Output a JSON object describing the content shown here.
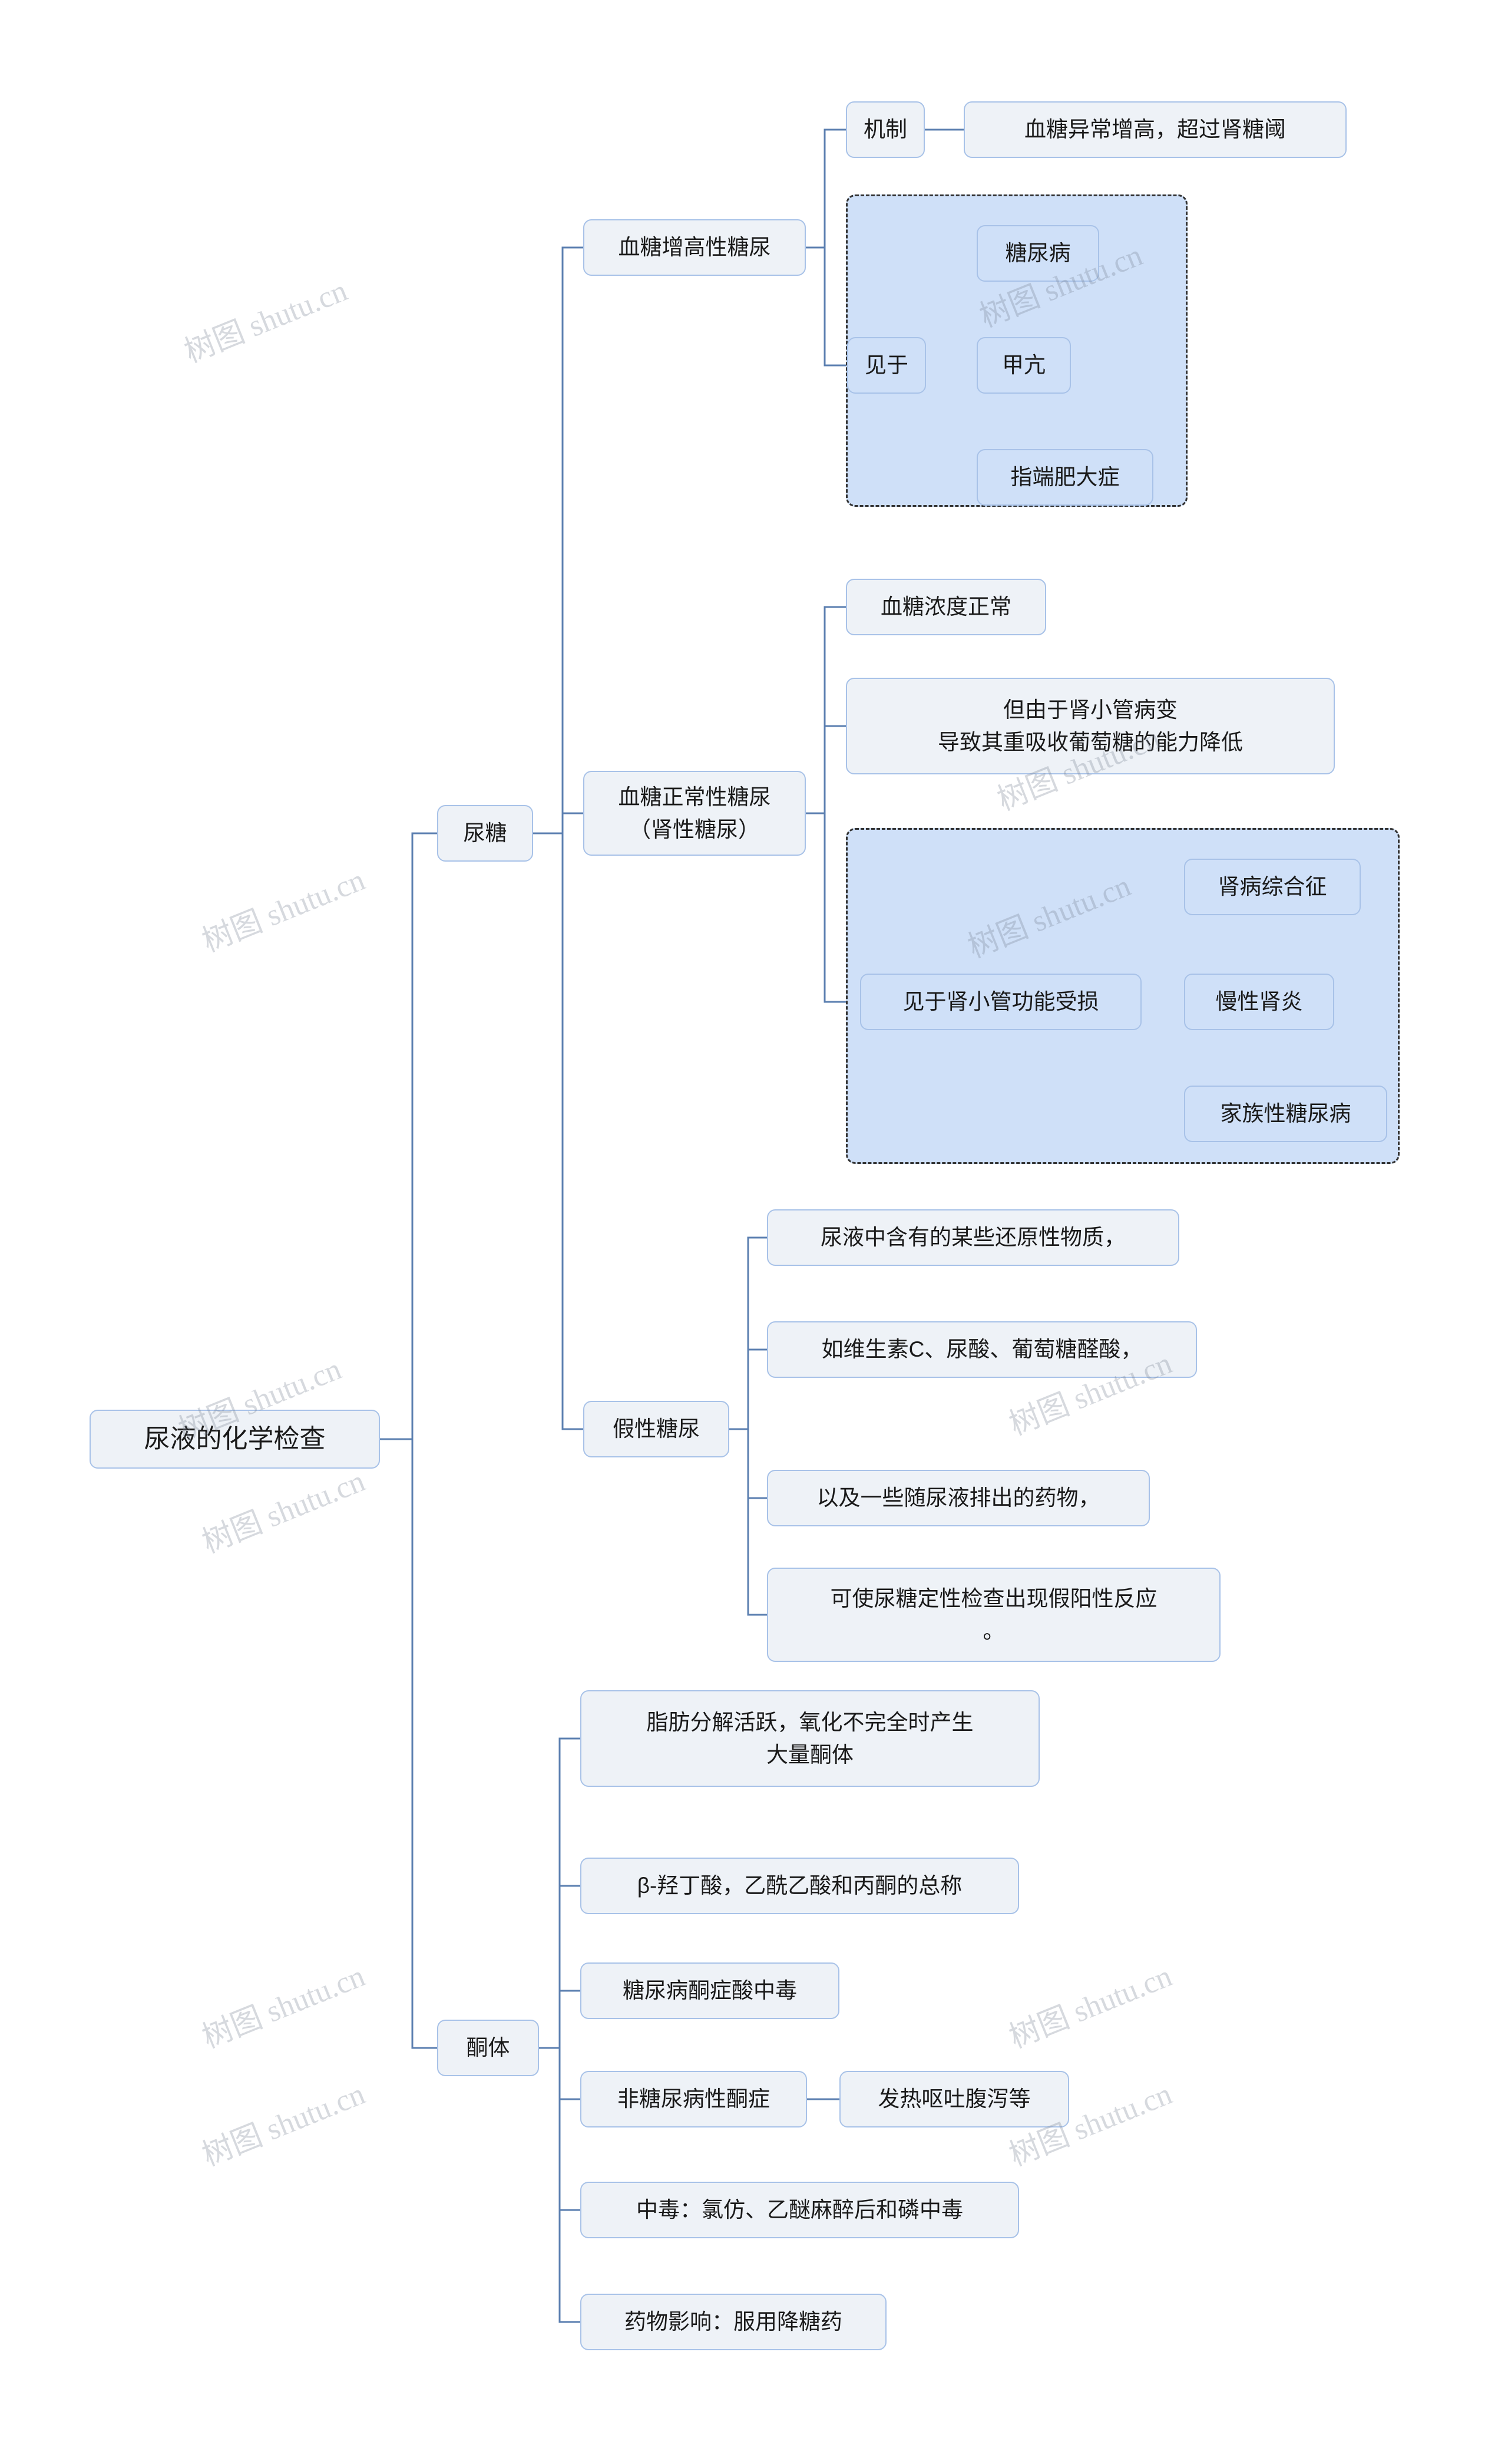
{
  "diagram": {
    "type": "mindmap",
    "title": "尿液的化学检查",
    "watermark_text": "树图 shutu.cn",
    "colors": {
      "node_border": "#a8c2e8",
      "node_fill": "#eef2f7",
      "highlight_fill": "#cfe0f8",
      "group_border": "#333333",
      "link": "#5b7fb0"
    },
    "nodes": {
      "root": "尿液的化学检查",
      "niaotang": "尿糖",
      "tongti": "酮体",
      "b1": "血糖增高性糖尿",
      "b1_mech_label": "机制",
      "b1_mech_text": "血糖异常增高，超过肾糖阈",
      "b1_seen_label": "见于",
      "b1_seen_1": "糖尿病",
      "b1_seen_2": "甲亢",
      "b1_seen_3": "指端肥大症",
      "b2": "血糖正常性糖尿\n（肾性糖尿）",
      "b2_1": "血糖浓度正常",
      "b2_2": "但由于肾小管病变\n导致其重吸收葡萄糖的能力降低",
      "b2_seen_label": "见于肾小管功能受损",
      "b2_seen_1": "肾病综合征",
      "b2_seen_2": "慢性肾炎",
      "b2_seen_3": "家族性糖尿病",
      "b3": "假性糖尿",
      "b3_1": "尿液中含有的某些还原性物质，",
      "b3_2": "如维生素C、尿酸、葡萄糖醛酸，",
      "b3_3": "以及一些随尿液排出的药物，",
      "b3_4": "可使尿糖定性检查出现假阳性反应\n。",
      "k_1": "脂肪分解活跃，氧化不完全时产生\n大量酮体",
      "k_2": "β-羟丁酸，乙酰乙酸和丙酮的总称",
      "k_3": "糖尿病酮症酸中毒",
      "k_4": "非糖尿病性酮症",
      "k_4_1": "发热呕吐腹泻等",
      "k_5": "中毒：氯仿、乙醚麻醉后和磷中毒",
      "k_6": "药物影响：服用降糖药"
    }
  }
}
